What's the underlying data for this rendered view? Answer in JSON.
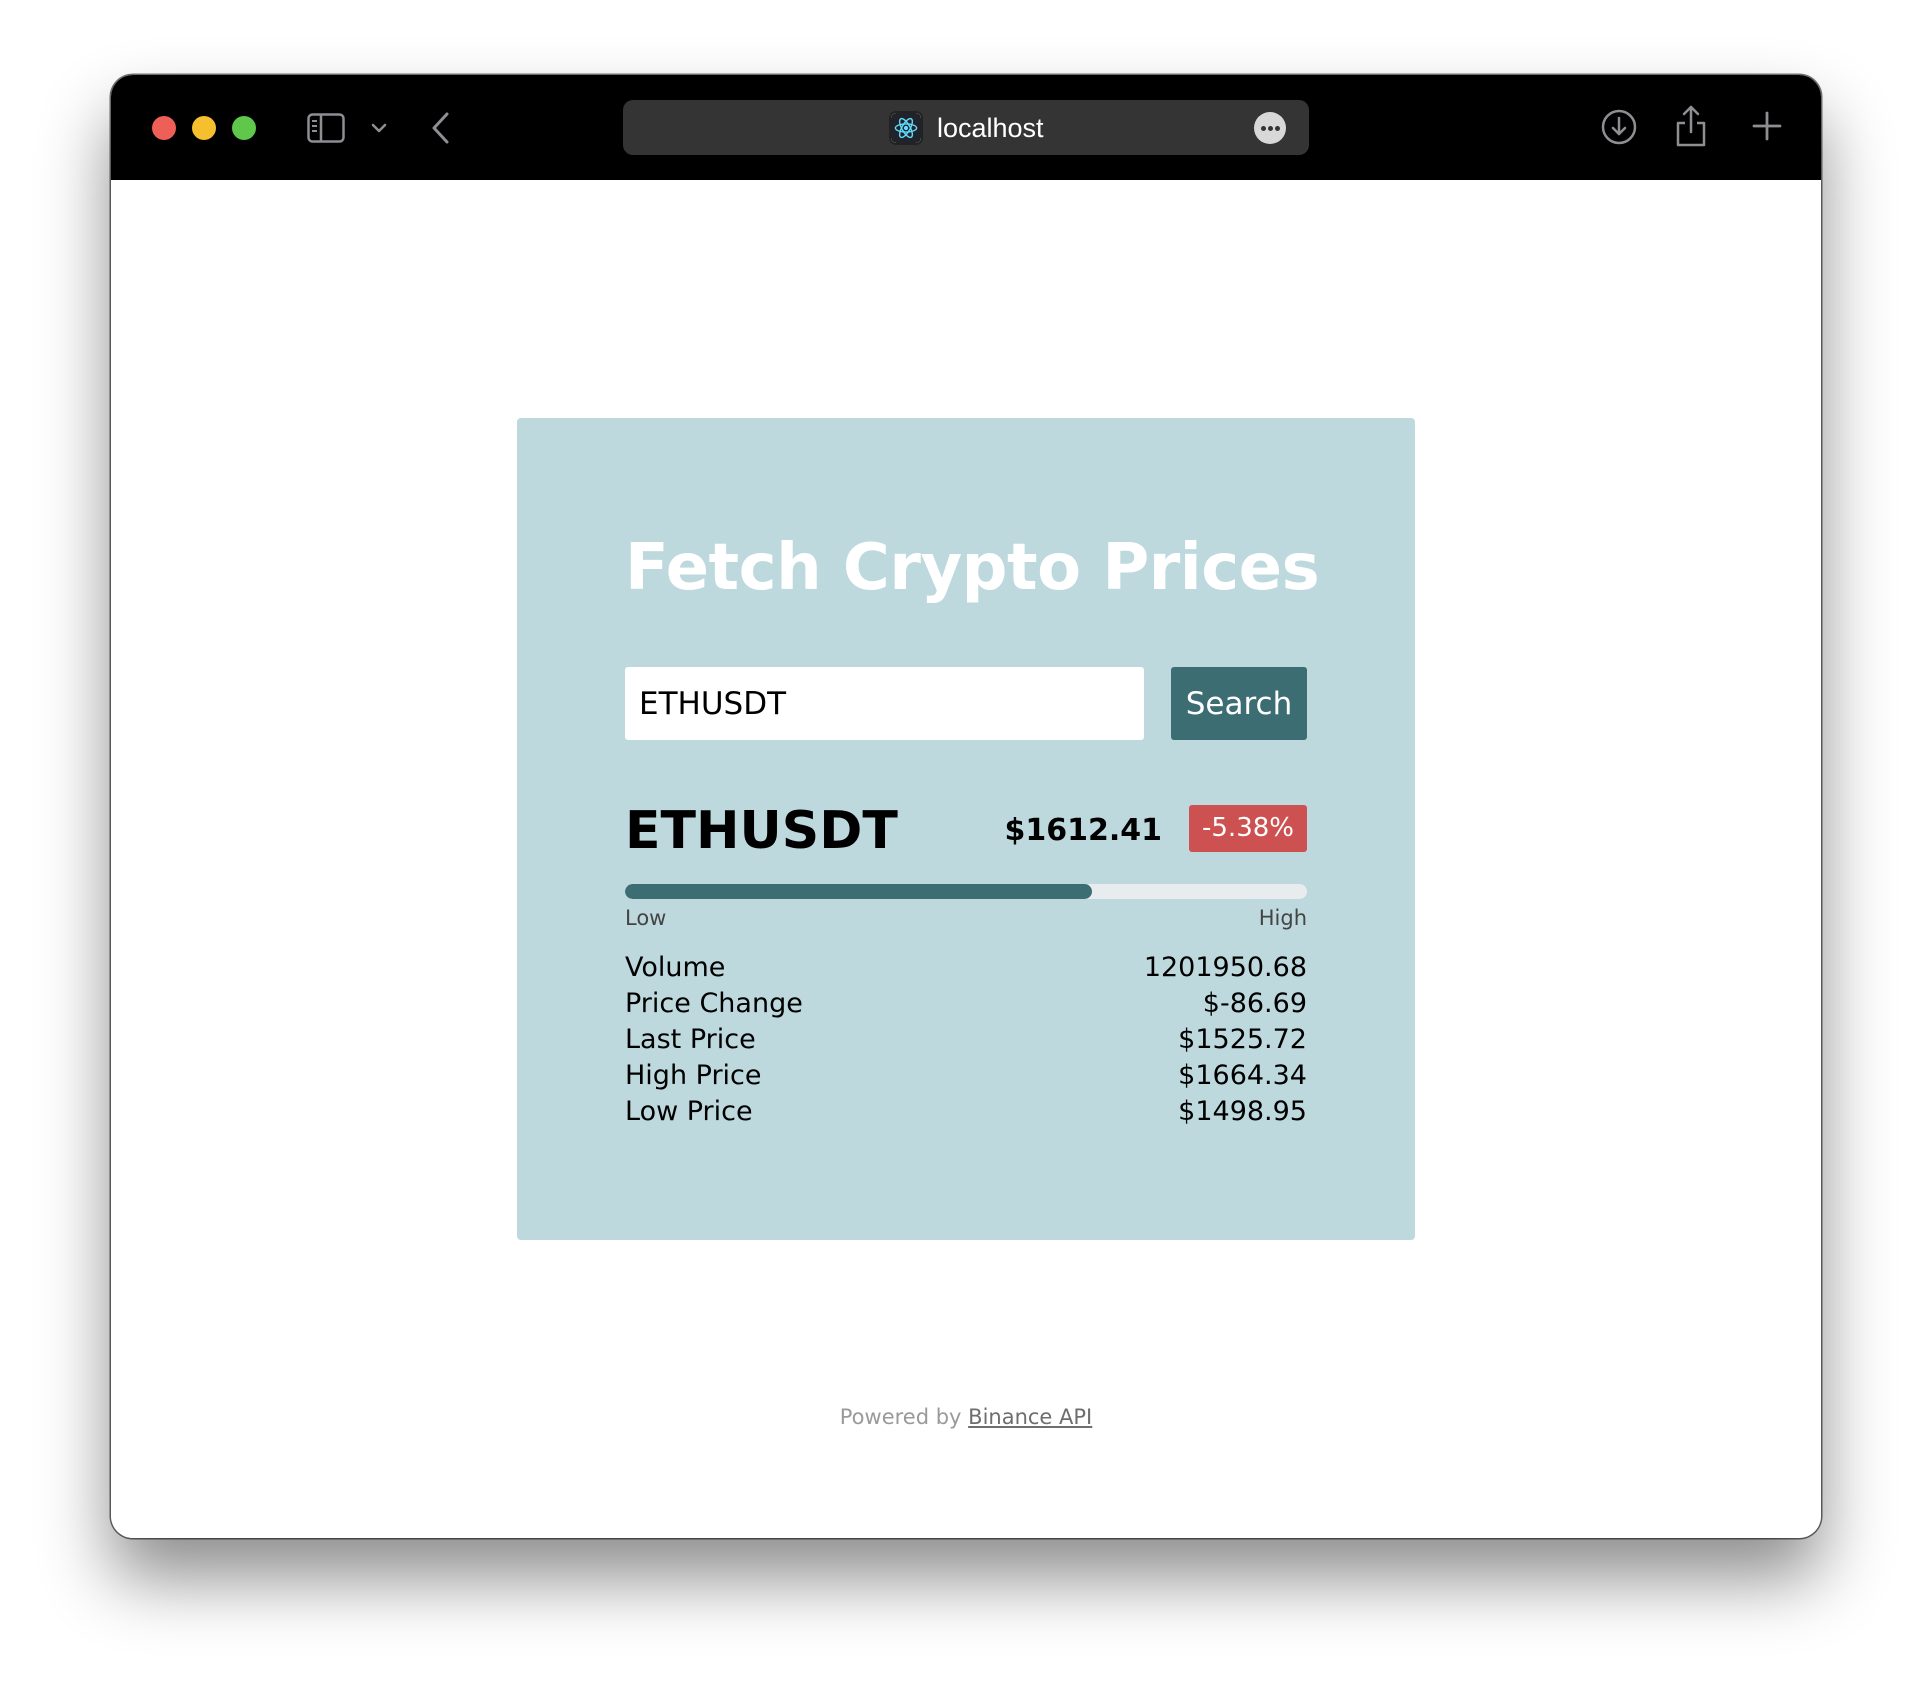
{
  "browser": {
    "url": "localhost",
    "icons": {
      "site": "react-atom-icon",
      "sidebar": "sidebar-icon",
      "chevron": "chevron-down-icon",
      "back": "chevron-left-icon",
      "more": "ellipsis-icon",
      "download": "download-icon",
      "share": "share-icon",
      "new_tab": "plus-icon"
    }
  },
  "app": {
    "title": "Fetch Crypto Prices",
    "search": {
      "value": "ETHUSDT",
      "button_label": "Search"
    },
    "ticker": {
      "symbol": "ETHUSDT",
      "price": "$1612.41",
      "change_percent": "-5.38%",
      "range_position": 0.685,
      "range_low_label": "Low",
      "range_high_label": "High"
    },
    "stats": [
      {
        "label": "Volume",
        "value": "1201950.68"
      },
      {
        "label": "Price Change",
        "value": "$-86.69"
      },
      {
        "label": "Last Price",
        "value": "$1525.72"
      },
      {
        "label": "High Price",
        "value": "$1664.34"
      },
      {
        "label": "Low Price",
        "value": "$1498.95"
      }
    ],
    "footer": {
      "prefix": "Powered by",
      "link_text": "Binance API"
    }
  },
  "colors": {
    "card_background": "#bdd9de",
    "accent": "#3b6d72",
    "negative_badge": "#cc5150",
    "track": "#e9ecef"
  }
}
